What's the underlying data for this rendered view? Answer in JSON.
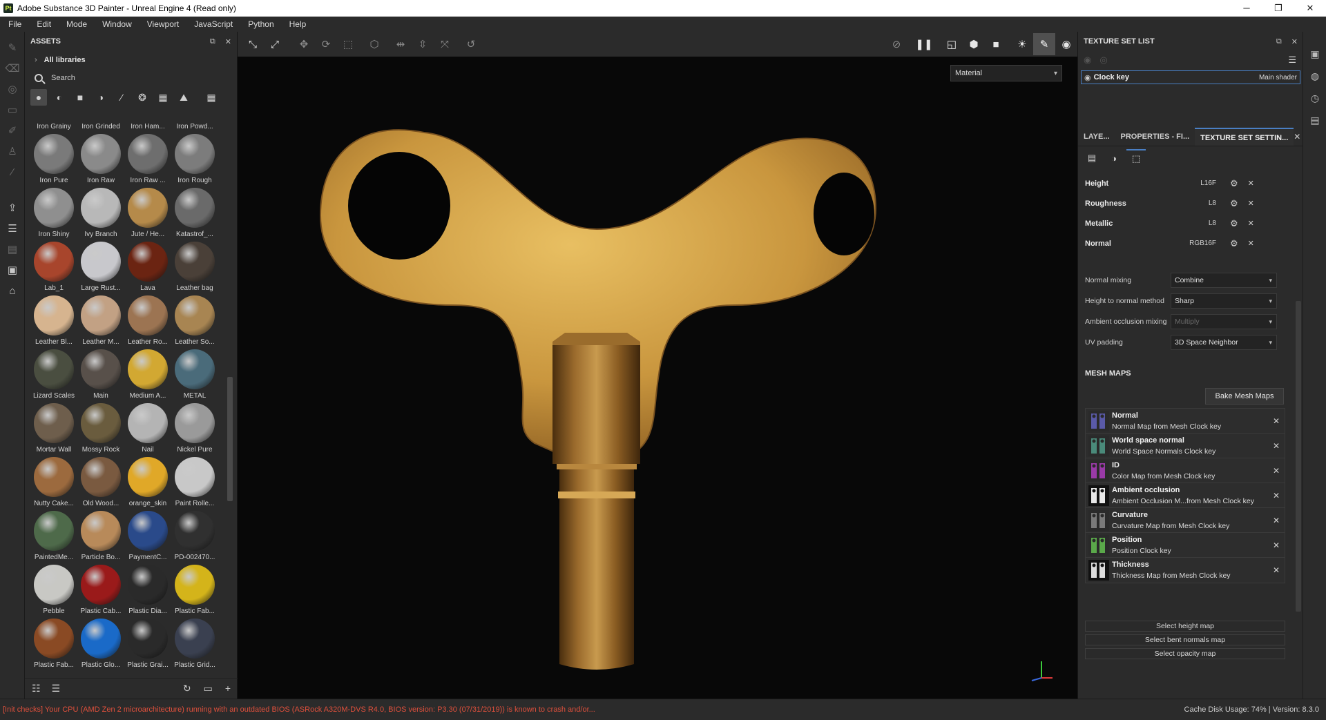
{
  "window": {
    "title": "Adobe Substance 3D Painter - Unreal Engine 4 (Read only)",
    "app_badge": "Pt"
  },
  "menu": [
    "File",
    "Edit",
    "Mode",
    "Window",
    "Viewport",
    "JavaScript",
    "Python",
    "Help"
  ],
  "assets": {
    "title": "ASSETS",
    "library": "All libraries",
    "search_placeholder": "Search",
    "items": [
      {
        "name": "Iron Grainy",
        "color": "#9a9a9a"
      },
      {
        "name": "Iron Grinded",
        "color": "#a0a0a0"
      },
      {
        "name": "Iron Ham...",
        "color": "#8c8c8c"
      },
      {
        "name": "Iron Powd...",
        "color": "#888888"
      },
      {
        "name": "Iron Pure",
        "color": "#7a7a7a"
      },
      {
        "name": "Iron Raw",
        "color": "#8a8a8a"
      },
      {
        "name": "Iron Raw ...",
        "color": "#6e6e6e"
      },
      {
        "name": "Iron Rough",
        "color": "#7c7c7c"
      },
      {
        "name": "Iron Shiny",
        "color": "#8f8f8f"
      },
      {
        "name": "Ivy Branch",
        "color": "#b8b8b8"
      },
      {
        "name": "Jute / He...",
        "color": "#b58a4a"
      },
      {
        "name": "Katastrof_...",
        "color": "#6a6a6a"
      },
      {
        "name": "Lab_1",
        "color": "#a8452c"
      },
      {
        "name": "Large Rust...",
        "color": "#c8c8cc"
      },
      {
        "name": "Lava",
        "color": "#6b2412"
      },
      {
        "name": "Leather bag",
        "color": "#4a4038"
      },
      {
        "name": "Leather Bl...",
        "color": "#d6b48f"
      },
      {
        "name": "Leather M...",
        "color": "#c2a184"
      },
      {
        "name": "Leather Ro...",
        "color": "#9c7452"
      },
      {
        "name": "Leather So...",
        "color": "#a88552"
      },
      {
        "name": "Lizard Scales",
        "color": "#4a4e40"
      },
      {
        "name": "Main",
        "color": "#58504a"
      },
      {
        "name": "Medium A...",
        "color": "#d2a832"
      },
      {
        "name": "METAL",
        "color": "#4a6b7a"
      },
      {
        "name": "Mortar Wall",
        "color": "#6e5e4c"
      },
      {
        "name": "Mossy Rock",
        "color": "#6a5c3e"
      },
      {
        "name": "Nail",
        "color": "#b4b4b4"
      },
      {
        "name": "Nickel Pure",
        "color": "#9a9a9a"
      },
      {
        "name": "Nutty Cake...",
        "color": "#9c6a3e"
      },
      {
        "name": "Old Wood...",
        "color": "#7a5a40"
      },
      {
        "name": "orange_skin",
        "color": "#e0a828"
      },
      {
        "name": "Paint Rolle...",
        "color": "#c8c8c8"
      },
      {
        "name": "PaintedMe...",
        "color": "#4e6a4a"
      },
      {
        "name": "Particle Bo...",
        "color": "#b88a5a"
      },
      {
        "name": "PaymentC...",
        "color": "#2a4a8a"
      },
      {
        "name": "PD-002470...",
        "color": "#303030"
      },
      {
        "name": "Pebble",
        "color": "#c8c8c4"
      },
      {
        "name": "Plastic Cab...",
        "color": "#9a1a1a"
      },
      {
        "name": "Plastic Dia...",
        "color": "#2a2a2a"
      },
      {
        "name": "Plastic Fab...",
        "color": "#d4b41a"
      },
      {
        "name": "Plastic Fab...",
        "color": "#8a4a24"
      },
      {
        "name": "Plastic Glo...",
        "color": "#1a6ac8"
      },
      {
        "name": "Plastic Grai...",
        "color": "#2a2a2a"
      },
      {
        "name": "Plastic Grid...",
        "color": "#3a4050"
      },
      {
        "name": "",
        "color": "#a01818"
      },
      {
        "name": "",
        "color": "#1a6ac8"
      },
      {
        "name": "",
        "color": "#3a3a3a"
      },
      {
        "name": "",
        "color": "#6a6a6a"
      }
    ]
  },
  "viewport": {
    "mode": "Material"
  },
  "texture_set_list": {
    "title": "TEXTURE SET LIST",
    "item_name": "Clock key",
    "item_shader": "Main shader"
  },
  "tabs": [
    "LAYE...",
    "PROPERTIES - FI...",
    "TEXTURE SET SETTIN..."
  ],
  "channels": [
    {
      "name": "Height",
      "format": "L16F"
    },
    {
      "name": "Roughness",
      "format": "L8"
    },
    {
      "name": "Metallic",
      "format": "L8"
    },
    {
      "name": "Normal",
      "format": "RGB16F"
    }
  ],
  "settings": [
    {
      "label": "Normal mixing",
      "value": "Combine"
    },
    {
      "label": "Height to normal method",
      "value": "Sharp"
    },
    {
      "label": "Ambient occlusion mixing",
      "value": "Multiply"
    },
    {
      "label": "UV padding",
      "value": "3D Space Neighbor"
    }
  ],
  "mesh_maps": {
    "title": "MESH MAPS",
    "bake_label": "Bake Mesh Maps",
    "items": [
      {
        "name": "Normal",
        "desc": "Normal Map from Mesh Clock key",
        "thumb": "#5a5aa8"
      },
      {
        "name": "World space normal",
        "desc": "World Space Normals Clock key",
        "thumb": "#4a8a7a"
      },
      {
        "name": "ID",
        "desc": "Color Map from Mesh Clock key",
        "thumb": "#9a3aa8"
      },
      {
        "name": "Ambient occlusion",
        "desc": "Ambient Occlusion M...from Mesh Clock key",
        "thumb": "#e8e8e8"
      },
      {
        "name": "Curvature",
        "desc": "Curvature Map from Mesh Clock key",
        "thumb": "#7a7a7a"
      },
      {
        "name": "Position",
        "desc": "Position Clock key",
        "thumb": "#5aa84a"
      },
      {
        "name": "Thickness",
        "desc": "Thickness Map from Mesh Clock key",
        "thumb": "#dcdcdc"
      }
    ],
    "select": [
      "Select height map",
      "Select bent normals map",
      "Select opacity map"
    ]
  },
  "status": {
    "message": "[Init checks] Your CPU (AMD Zen 2 microarchitecture) running with an outdated BIOS (ASRock A320M-DVS R4.0, BIOS version: P3.30 (07/31/2019)) is known to crash and/or...",
    "right": "Cache Disk Usage:   74% | Version: 8.3.0"
  },
  "icons": {
    "minimize": "─",
    "maximize": "❐",
    "close": "✕"
  }
}
